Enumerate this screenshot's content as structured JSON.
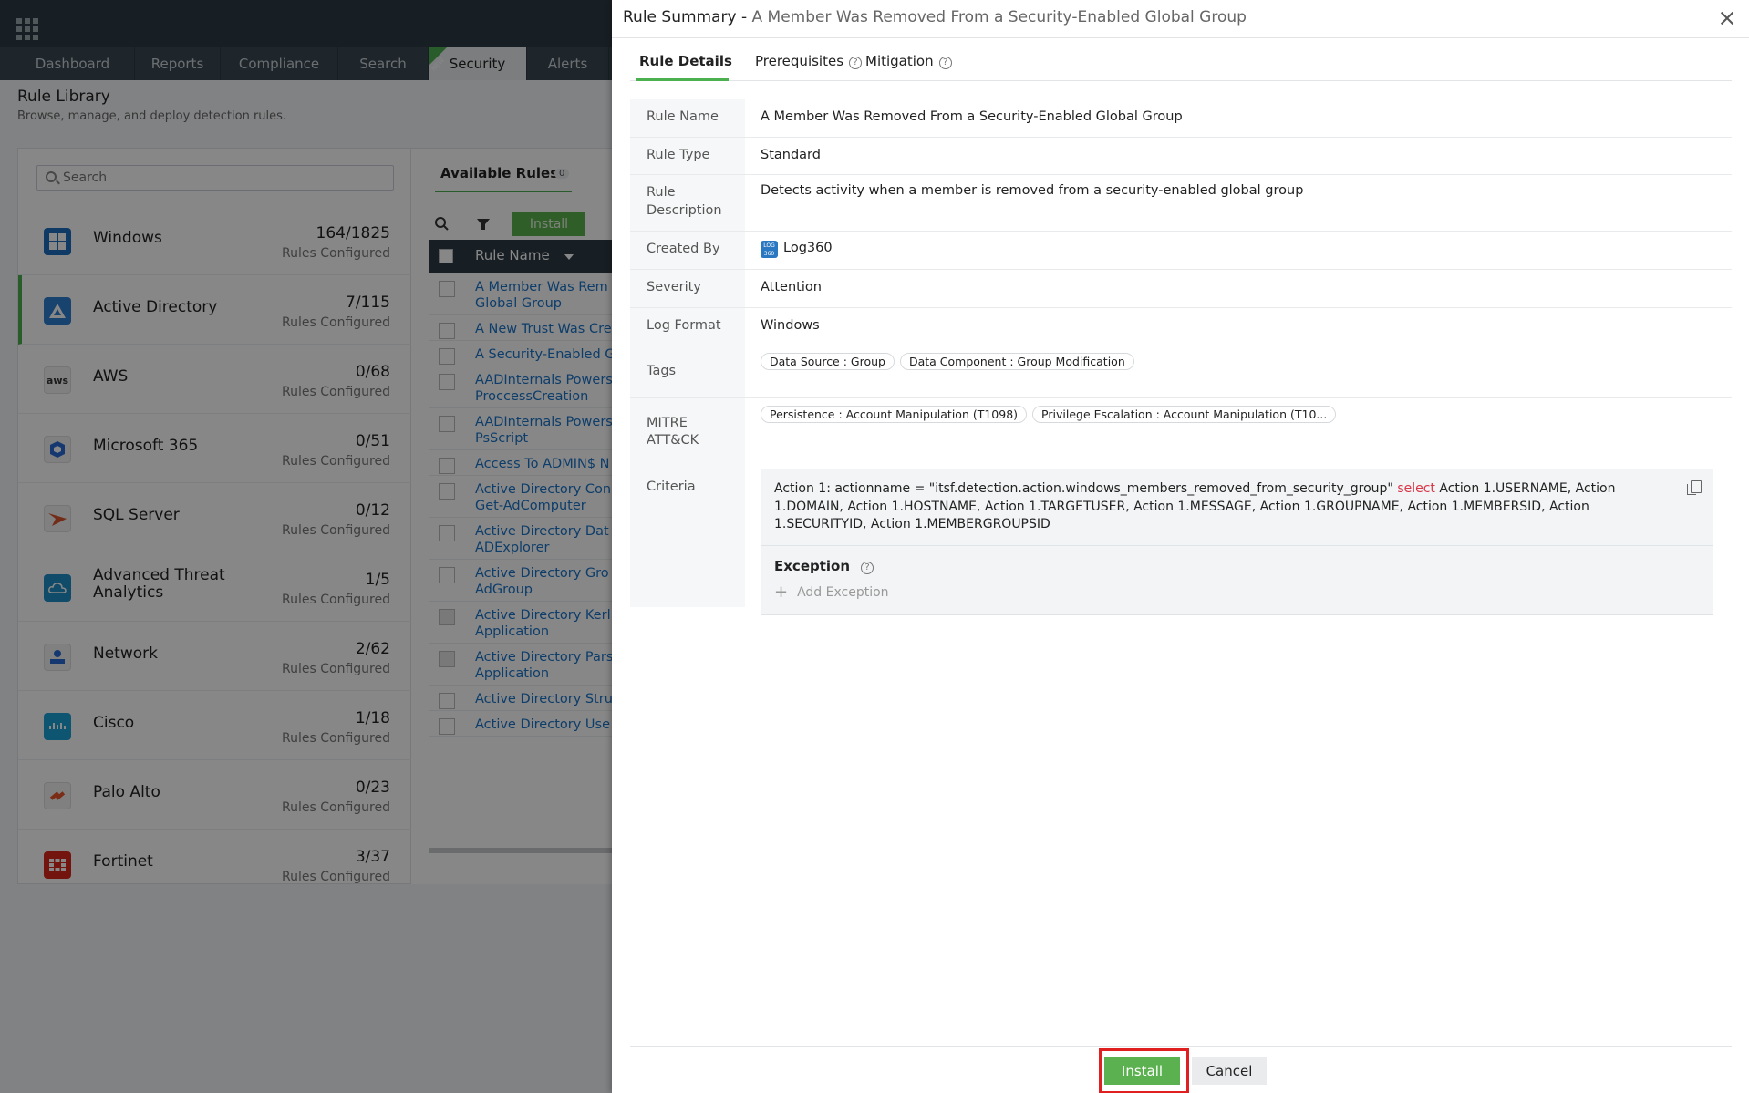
{
  "nav": {
    "tabs": [
      "Dashboard",
      "Reports",
      "Compliance",
      "Search",
      "Security",
      "Alerts"
    ],
    "new_badge": "NEW"
  },
  "library": {
    "title": "Rule Library",
    "subtitle": "Browse, manage, and deploy detection rules.",
    "search_placeholder": "Search",
    "sources": [
      {
        "name": "Windows",
        "count": "164/1825",
        "label": "Rules Configured",
        "icon": "windows-icon"
      },
      {
        "name": "Active Directory",
        "count": "7/115",
        "label": "Rules Configured",
        "icon": "active-directory-icon"
      },
      {
        "name": "AWS",
        "count": "0/68",
        "label": "Rules Configured",
        "icon": "aws-icon"
      },
      {
        "name": "Microsoft 365",
        "count": "0/51",
        "label": "Rules Configured",
        "icon": "microsoft-365-icon"
      },
      {
        "name": "SQL Server",
        "count": "0/12",
        "label": "Rules Configured",
        "icon": "sql-server-icon"
      },
      {
        "name": "Advanced Threat Analytics",
        "count": "1/5",
        "label": "Rules Configured",
        "icon": "advanced-threat-analytics-icon"
      },
      {
        "name": "Network",
        "count": "2/62",
        "label": "Rules Configured",
        "icon": "network-icon"
      },
      {
        "name": "Cisco",
        "count": "1/18",
        "label": "Rules Configured",
        "icon": "cisco-icon"
      },
      {
        "name": "Palo Alto",
        "count": "0/23",
        "label": "Rules Configured",
        "icon": "palo-alto-icon"
      },
      {
        "name": "Fortinet",
        "count": "3/37",
        "label": "Rules Configured",
        "icon": "fortinet-icon"
      }
    ]
  },
  "rules": {
    "title": "Available Rules",
    "count": "0",
    "install_label": "Install",
    "column": "Rule Name",
    "rows": [
      [
        "A Member Was Rem",
        "Global Group"
      ],
      [
        "A New Trust Was Cre"
      ],
      [
        "A Security-Enabled G"
      ],
      [
        "AADInternals Powers",
        "ProccessCreation"
      ],
      [
        "AADInternals Powers",
        "PsScript"
      ],
      [
        "Access To ADMIN$ N"
      ],
      [
        "Active Directory Con",
        "Get-AdComputer"
      ],
      [
        "Active Directory Dat",
        "ADExplorer"
      ],
      [
        "Active Directory Gro",
        "AdGroup"
      ],
      [
        "Active Directory Kerl",
        "Application"
      ],
      [
        "Active Directory Pars",
        "Application"
      ],
      [
        "Active Directory Stru"
      ],
      [
        "Active Directory Use"
      ]
    ]
  },
  "drawer": {
    "title_prefix": "Rule Summary -",
    "title": "A Member Was Removed From a Security-Enabled Global Group",
    "tabs": [
      "Rule Details",
      "Prerequisites",
      "Mitigation"
    ],
    "fields": {
      "rule_name_label": "Rule Name",
      "rule_name": "A Member Was Removed From a Security-Enabled Global Group",
      "rule_type_label": "Rule Type",
      "rule_type": "Standard",
      "description_label": "Rule Description",
      "description": "Detects activity when a member is removed from a security-enabled global group",
      "created_by_label": "Created By",
      "created_by": "Log360",
      "severity_label": "Severity",
      "severity": "Attention",
      "log_format_label": "Log Format",
      "log_format": "Windows",
      "tags_label": "Tags",
      "tags": [
        "Data Source : Group",
        "Data Component : Group Modification"
      ],
      "mitre_label": "MITRE ATT&CK",
      "mitre": [
        "Persistence : Account Manipulation (T1098)",
        "Privilege Escalation : Account Manipulation (T10..."
      ],
      "criteria_label": "Criteria",
      "criteria_prefix": "Action 1: actionname = \"itsf.detection.action.windows_members_removed_from_security_group\"",
      "criteria_keyword": "select",
      "criteria_suffix": "Action 1.USERNAME, Action 1.DOMAIN, Action 1.HOSTNAME, Action 1.TARGETUSER, Action 1.MESSAGE, Action 1.GROUPNAME, Action 1.MEMBERSID, Action 1.SECURITYID, Action 1.MEMBERGROUPSID",
      "exception_label": "Exception",
      "add_exception": "Add Exception"
    },
    "install_label": "Install",
    "cancel_label": "Cancel"
  }
}
